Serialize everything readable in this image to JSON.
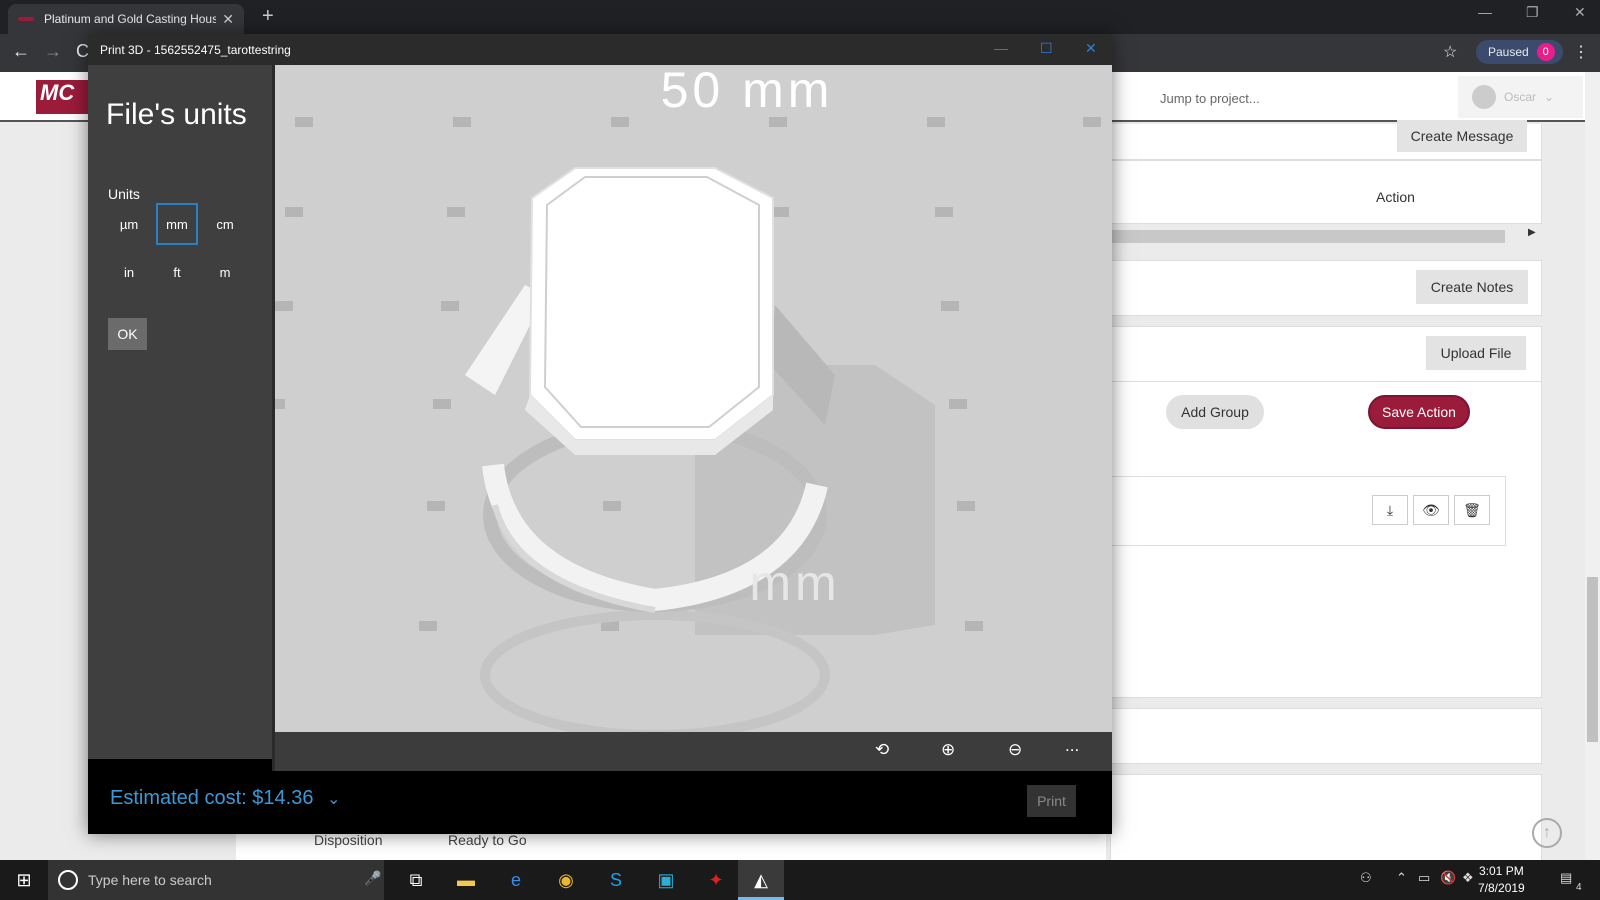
{
  "browser": {
    "tab_title": "Platinum and Gold Casting House",
    "new_tab": "+",
    "paused_label": "Paused",
    "paused_count": "0"
  },
  "webpage": {
    "logo_text": "MC",
    "jump_placeholder": "Jump to project...",
    "user_name": "Oscar",
    "create_message": "Create Message",
    "action_header": "Action",
    "create_notes": "Create Notes",
    "upload_file": "Upload File",
    "add_group": "Add Group",
    "save_action": "Save Action",
    "disposition_label": "Disposition",
    "disposition_value": "Ready to Go"
  },
  "print3d": {
    "window_title": "Print 3D - 1562552475_tarottestring",
    "panel_title": "File's units",
    "units_label": "Units",
    "units": [
      "µm",
      "mm",
      "cm",
      "in",
      "ft",
      "m"
    ],
    "selected_unit": "mm",
    "ok_label": "OK",
    "scale_text_top": "50 mm",
    "scale_text_bottom": "mm",
    "estimated_cost": "Estimated cost: $14.36",
    "print_label": "Print",
    "more_label": "..."
  },
  "taskbar": {
    "search_placeholder": "Type here to search",
    "time": "3:01 PM",
    "date": "7/8/2019",
    "notification_count": "4"
  },
  "colors": {
    "accent_blue": "#2b7fc5",
    "cost_blue": "#3a9ad9",
    "brand_red": "#9b1b3b"
  }
}
